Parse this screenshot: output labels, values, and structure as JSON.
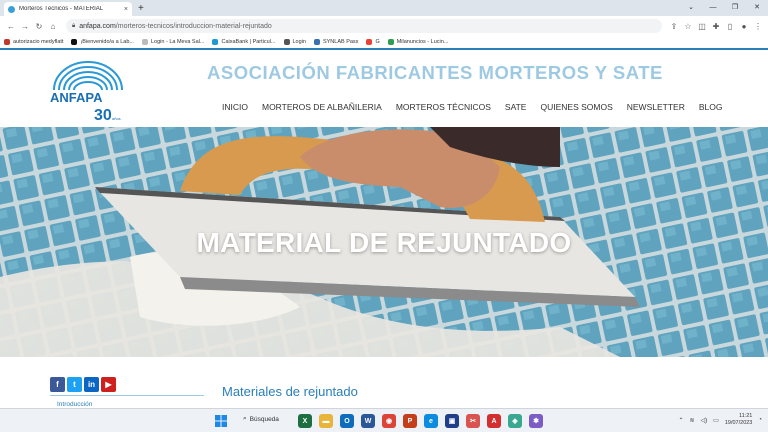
{
  "browser": {
    "tab_title": "Morteros Técnicos - MATERIAL",
    "tab_close": "×",
    "new_tab": "+",
    "url_domain": "anfapa.com",
    "url_path": "/morteros-tecnicos/introduccion-material-rejuntado",
    "window_controls": [
      "⌄",
      "—",
      "❐",
      "✕"
    ],
    "bookmarks": [
      {
        "label": "autorizacio medyflatt",
        "color": "#c0392b"
      },
      {
        "label": "¡Bienvenido/a a Lab...",
        "color": "#111111"
      },
      {
        "label": "Login - La Meva Sal...",
        "color": "#bbbbbb"
      },
      {
        "label": "CaixaBank | Particul...",
        "color": "#1b9ad6"
      },
      {
        "label": "Login",
        "color": "#555555"
      },
      {
        "label": "SYNLAB Pass",
        "color": "#3a6fb0"
      },
      {
        "label": "G",
        "color": "#ea4335"
      },
      {
        "label": "Milanuncios - Lucin...",
        "color": "#2e9e4f"
      }
    ]
  },
  "site": {
    "logo_text": "ANFAPA",
    "logo_years": "30",
    "logo_years_label": "años",
    "title": "ASOCIACIÓN FABRICANTES MORTEROS Y SATE",
    "nav": [
      "INICIO",
      "MORTEROS DE ALBAÑILERIA",
      "MORTEROS TÉCNICOS",
      "SATE",
      "QUIENES SOMOS",
      "NEWSLETTER",
      "BLOG"
    ],
    "hero_title": "MATERIAL DE REJUNTADO",
    "section_title": "Materiales de rejuntado",
    "side_link": "Introducción",
    "social": [
      {
        "icon": "facebook-icon",
        "glyph": "f",
        "color": "#3b5998"
      },
      {
        "icon": "twitter-icon",
        "glyph": "t",
        "color": "#1da1f2"
      },
      {
        "icon": "linkedin-icon",
        "glyph": "in",
        "color": "#0a66c2"
      },
      {
        "icon": "youtube-icon",
        "glyph": "▶",
        "color": "#cd201f"
      }
    ]
  },
  "taskbar": {
    "search_label": "Búsqueda",
    "time": "11:21",
    "date": "19/07/2023",
    "apps": [
      {
        "icon": "excel-icon",
        "glyph": "X",
        "color": "#1d6f42"
      },
      {
        "icon": "file-explorer-icon",
        "glyph": "▬",
        "color": "#e8b43a"
      },
      {
        "icon": "outlook-icon",
        "glyph": "O",
        "color": "#0f6cbd"
      },
      {
        "icon": "word-icon",
        "glyph": "W",
        "color": "#2b579a"
      },
      {
        "icon": "chrome-icon",
        "glyph": "◉",
        "color": "#db4437"
      },
      {
        "icon": "powerpoint-icon",
        "glyph": "P",
        "color": "#c43e1c"
      },
      {
        "icon": "edge-icon",
        "glyph": "e",
        "color": "#0c8ce0"
      },
      {
        "icon": "app-icon",
        "glyph": "▣",
        "color": "#1f3f8a"
      },
      {
        "icon": "snip-icon",
        "glyph": "✂",
        "color": "#d9534f"
      },
      {
        "icon": "acrobat-icon",
        "glyph": "A",
        "color": "#d32f2f"
      },
      {
        "icon": "photos-icon",
        "glyph": "◈",
        "color": "#3aa890"
      },
      {
        "icon": "teams-icon",
        "glyph": "✱",
        "color": "#7b5cc4"
      }
    ]
  }
}
